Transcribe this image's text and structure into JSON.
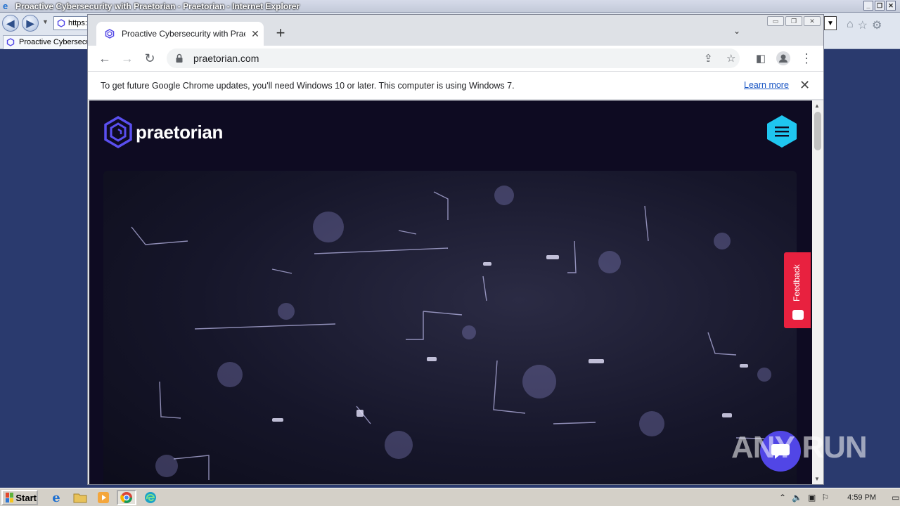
{
  "ie": {
    "title": "Proactive Cybersecurity with Praetorian - Praetorian - Internet Explorer",
    "address_text": "https:",
    "tab_label": "Proactive Cybersecurity with Praetorian"
  },
  "chrome": {
    "tab_title": "Proactive Cybersecurity with Praetorian",
    "url": "praetorian.com",
    "infobar": {
      "message": "To get future Google Chrome updates, you'll need Windows 10 or later. This computer is using Windows 7.",
      "link_label": "Learn more"
    }
  },
  "page": {
    "brand": "praetorian",
    "feedback_label": "Feedback",
    "colors": {
      "background": "#0e0b22",
      "brand_purple": "#5146e6",
      "menu_cyan": "#1fc6f0",
      "feedback_red": "#e8213f"
    }
  },
  "watermark": "ANY RUN",
  "taskbar": {
    "start_label": "Start",
    "clock": "4:59 PM",
    "apps": [
      "ie-icon",
      "folder-icon",
      "media-player-icon",
      "chrome-icon",
      "edge-icon"
    ]
  }
}
